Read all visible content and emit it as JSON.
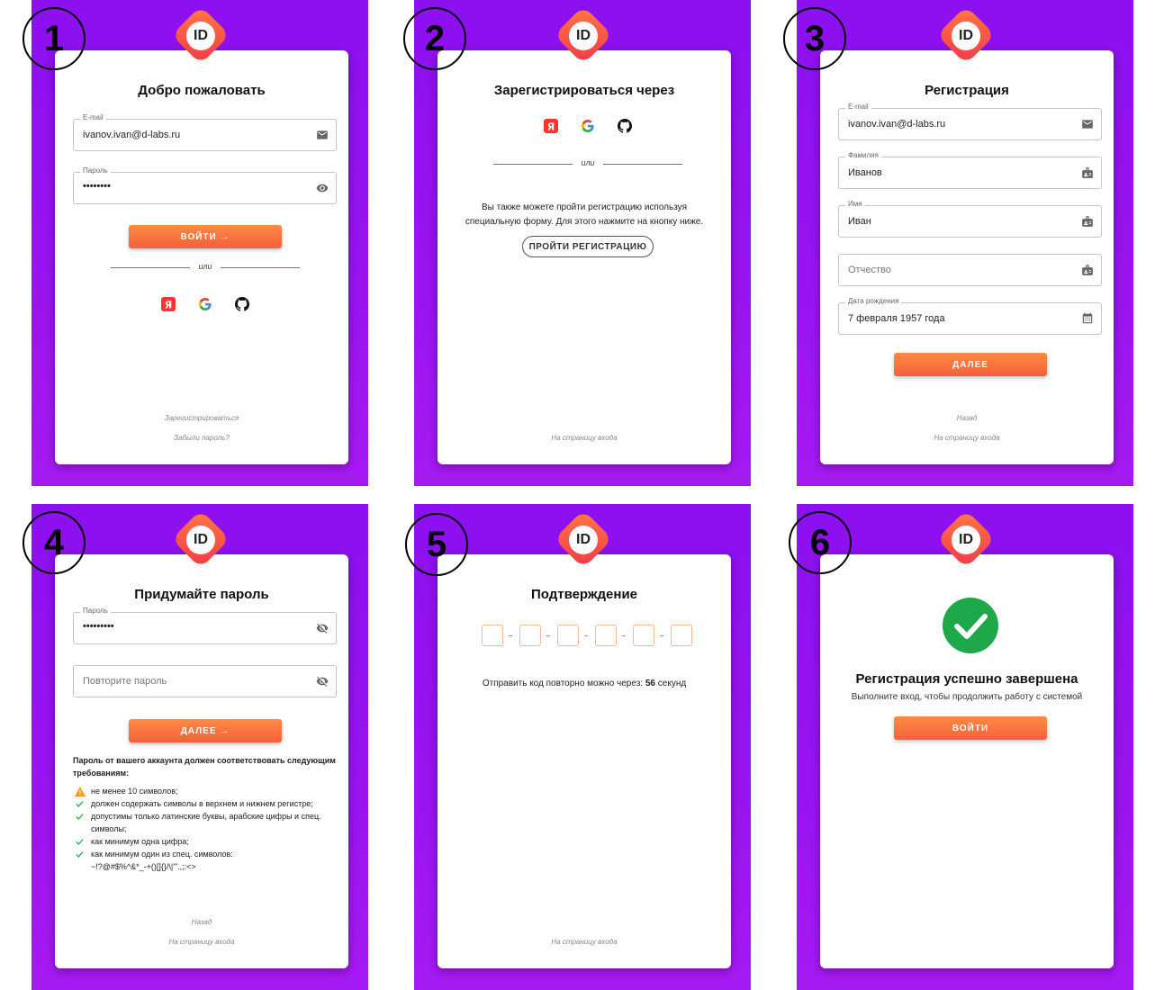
{
  "logo_text": "ID",
  "badges": [
    "1",
    "2",
    "3",
    "4",
    "5",
    "6"
  ],
  "screen1": {
    "title": "Добро пожаловать",
    "email_label": "E-mail",
    "email_value": "ivanov.ivan@d-labs.ru",
    "password_label": "Пароль",
    "password_value": "••••••••",
    "login_button": "ВОЙТИ →",
    "or_text": "или",
    "register_link": "Зарегистрироваться",
    "forgot_link": "Забыли пароль?"
  },
  "screen2": {
    "title": "Зарегистрироваться через",
    "or_text": "или",
    "info_line1": "Вы также можете пройти регистрацию используя",
    "info_line2": "специальную форму. Для этого нажмите на кнопку ниже.",
    "register_button": "ПРОЙТИ РЕГИСТРАЦИЮ",
    "login_page_link": "На страницу входа"
  },
  "screen3": {
    "title": "Регистрация",
    "email_label": "E-mail",
    "email_value": "ivanov.ivan@d-labs.ru",
    "lastname_label": "Фамилия",
    "lastname_value": "Иванов",
    "firstname_label": "Имя",
    "firstname_value": "Иван",
    "patronymic_placeholder": "Отчество",
    "birthdate_label": "Дата рождения",
    "birthdate_value": "7 февраля 1957 года",
    "next_button": "ДАЛЕЕ",
    "back_link": "Назад",
    "login_page_link": "На страницу входа"
  },
  "screen4": {
    "title": "Придумайте пароль",
    "password_label": "Пароль",
    "password_value": "•••••••••",
    "repeat_placeholder": "Повторите пароль",
    "next_button": "ДАЛЕЕ →",
    "requirements_title": "Пароль от вашего аккаунта должен соответствовать следующим требованиям:",
    "requirements": [
      {
        "status": "warning",
        "text": "не менее 10 символов;"
      },
      {
        "status": "ok",
        "text": "должен содержать символы в верхнем и нижнем регистре;"
      },
      {
        "status": "ok",
        "text": "допустимы только латинские буквы, арабские цифры и спец. символы;"
      },
      {
        "status": "ok",
        "text": "как минимум одна цифра;"
      },
      {
        "status": "ok",
        "text": "как минимум один из спец. символов:"
      }
    ],
    "special_chars": "~!?@#$%^&*_-+()[]{}/\\|'\".,;:<>",
    "back_link": "Назад",
    "login_page_link": "На страницу входа"
  },
  "screen5": {
    "title": "Подтверждение",
    "resend_prefix": "Отправить код повторно можно через:",
    "resend_seconds": "56",
    "resend_suffix": "секунд",
    "login_page_link": "На страницу входа"
  },
  "screen6": {
    "title": "Регистрация успешно завершена",
    "subtitle": "Выполните вход, чтобы продолжить работу с системой",
    "login_button": "ВОЙТИ"
  },
  "colors": {
    "background_purple": "#9212f0",
    "accent_orange": "#f4603a",
    "success_green": "#1fa84a"
  }
}
